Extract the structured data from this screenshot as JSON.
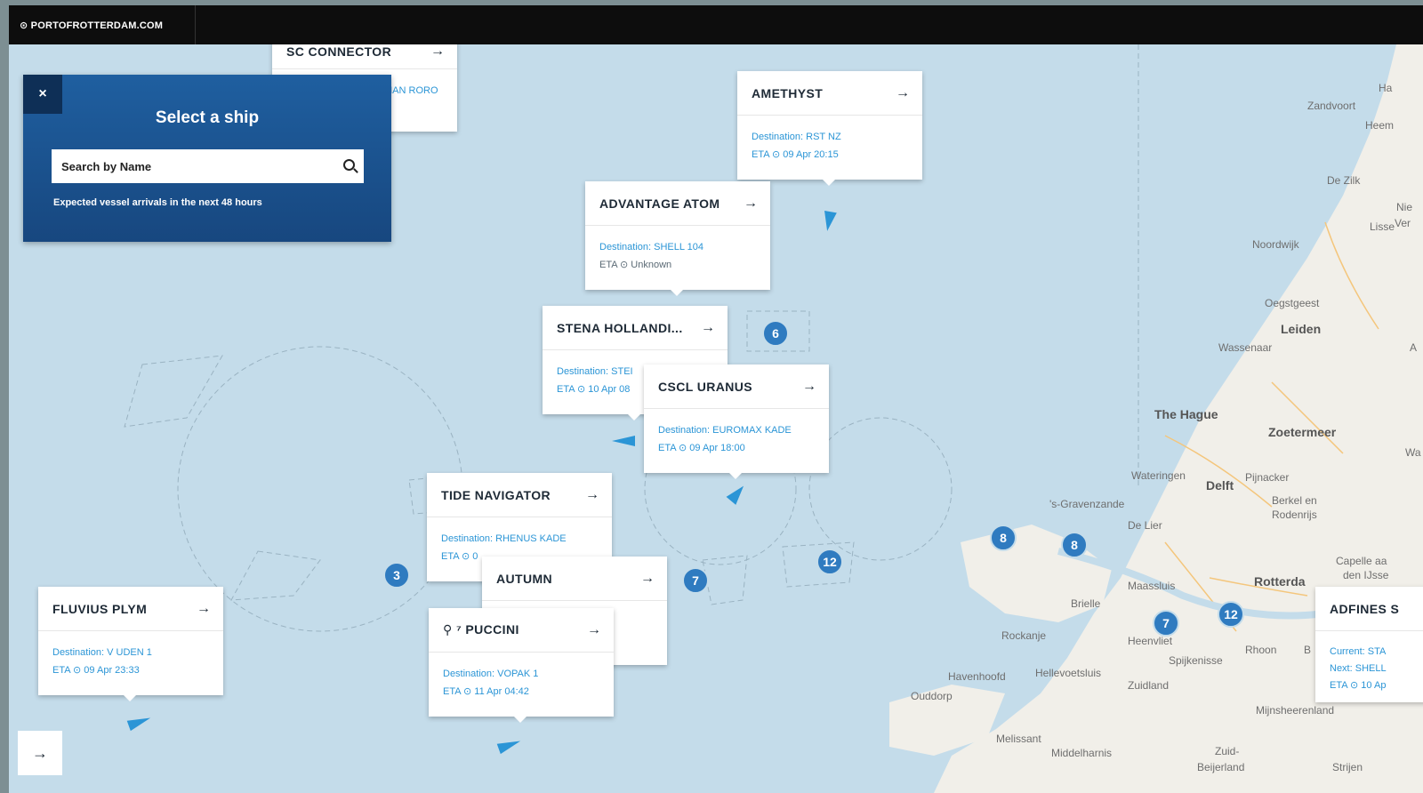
{
  "topbar": {
    "brand": "⊙ PORTOFROTTERDAM.COM"
  },
  "select_panel": {
    "close": "×",
    "title": "Select a ship",
    "search_placeholder": "Search by Name",
    "note": "Expected vessel arrivals in the next 48 hours"
  },
  "cards": {
    "sc_connector": {
      "name": "SC CONNECTOR",
      "dest_partial": "MAN RORO"
    },
    "amethyst": {
      "name": "AMETHYST",
      "dest": "Destination: RST NZ",
      "eta": "ETA ⊙ 09 Apr 20:15"
    },
    "advantage_atom": {
      "name": "ADVANTAGE ATOM",
      "dest": "Destination: SHELL 104",
      "eta": "ETA ⊙ Unknown"
    },
    "stena": {
      "name": "STENA HOLLANDI...",
      "dest": "Destination: STEI",
      "eta": "ETA ⊙ 10 Apr 08"
    },
    "cscl_uranus": {
      "name": "CSCL URANUS",
      "dest": "Destination: EUROMAX KADE",
      "eta": "ETA ⊙ 09 Apr 18:00"
    },
    "tide_navigator": {
      "name": "TIDE NAVIGATOR",
      "dest": "Destination: RHENUS KADE",
      "eta": "ETA ⊙ 0"
    },
    "autumn": {
      "name": "AUTUMN"
    },
    "puccini": {
      "name": "⚲ ⁷ PUCCINI",
      "dest": "Destination: VOPAK 1",
      "eta": "ETA ⊙ 11 Apr 04:42"
    },
    "fluvius": {
      "name": "FLUVIUS PLYM",
      "dest": "Destination: V UDEN 1",
      "eta": "ETA ⊙ 09 Apr 23:33"
    },
    "adfines": {
      "name": "ADFINES S",
      "current": "Current: STA",
      "next": "Next: SHELL",
      "eta": "ETA ⊙ 10 Ap"
    }
  },
  "arrow": "→",
  "clusters": [
    "6",
    "3",
    "7",
    "12",
    "8",
    "8",
    "7",
    "12"
  ],
  "places": {
    "zandvoort": "Zandvoort",
    "haarlem": "Ha",
    "heemstede": "Heem",
    "dezilk": "De Zilk",
    "lisse": "Lisse",
    "nie": "Nie",
    "ver": "Ver",
    "noordwijk": "Noordwijk",
    "oegstgeest": "Oegstgeest",
    "leiden": "Leiden",
    "wassenaar": "Wassenaar",
    "a": "A",
    "thehague": "The Hague",
    "zoetermeer": "Zoetermeer",
    "wa": "Wa",
    "wateringen": "Wateringen",
    "delft": "Delft",
    "pijnacker": "Pijnacker",
    "berkel": "Berkel en",
    "rodenrijs": "Rodenrijs",
    "gravenzande": "'s-Gravenzande",
    "delier": "De Lier",
    "capelle": "Capelle aa",
    "denijssel": "den IJsse",
    "maassluis": "Maassluis",
    "rotterdam": "Rotterda",
    "brielle": "Brielle",
    "rockanje": "Rockanje",
    "heenvliet": "Heenvliet",
    "spijkenisse": "Spijkenisse",
    "rhoon": "Rhoon",
    "b": "B",
    "hellevoetsluis": "Hellevoetsluis",
    "havenhoofd": "Havenhoofd",
    "zuidland": "Zuidland",
    "ouddorp": "Ouddorp",
    "mijnsheerenland": "Mijnsheerenland",
    "melissant": "Melissant",
    "middelharnis": "Middelharnis",
    "zuid": "Zuid-",
    "beijerland": "Beijerland",
    "strijen": "Strijen"
  },
  "colors": {
    "sea": "#c4dcea",
    "land": "#f1efe9",
    "accent": "#2b95d6",
    "panel": "#1f5fa0",
    "cluster": "#2f7bc0"
  }
}
